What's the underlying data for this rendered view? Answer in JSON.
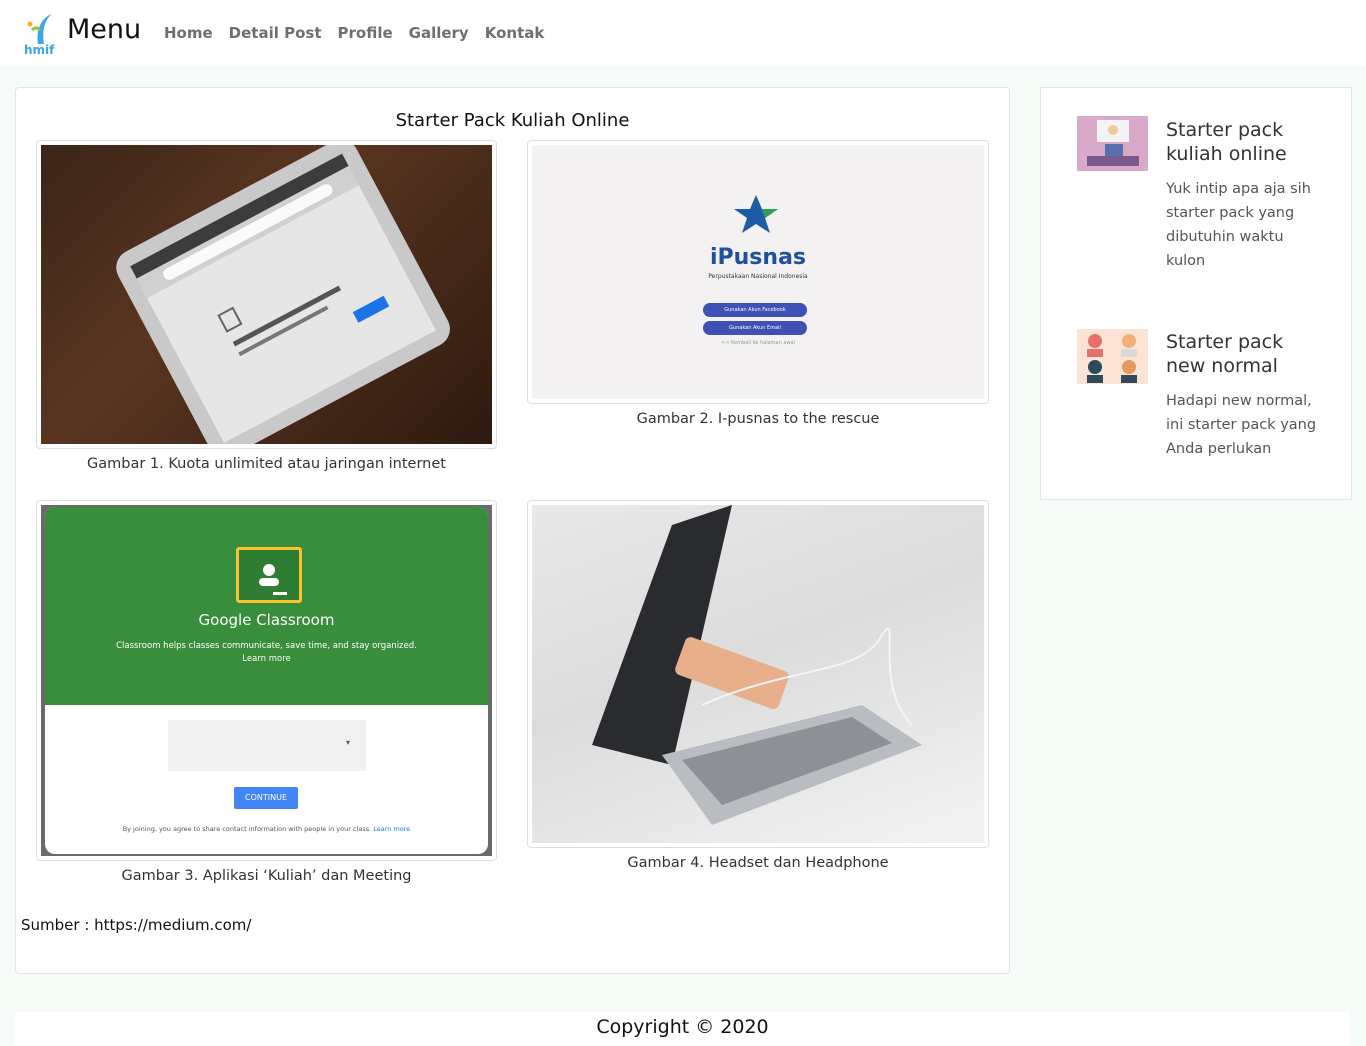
{
  "nav": {
    "logo_text": "hmif",
    "brand": "Menu",
    "links": [
      "Home",
      "Detail Post",
      "Profile",
      "Gallery",
      "Kontak"
    ]
  },
  "article": {
    "title": "Starter Pack Kuliah Online",
    "figures": [
      {
        "caption": "Gambar 1. Kuota unlimited atau jaringan internet",
        "image": "tablet-browser-photo"
      },
      {
        "caption": "Gambar 2. I-pusnas to the rescue",
        "image": "ipusnas-login-screen",
        "image_text": {
          "app_name": "iPusnas",
          "subtitle": "Perpustakaan Nasional Indonesia",
          "btn1": "Gunakan Akun Facebook",
          "btn2": "Gunakan Akun Email",
          "back": "<< Kembali ke halaman awal"
        }
      },
      {
        "caption": "Gambar 3. Aplikasi ‘Kuliah’ dan Meeting",
        "image": "google-classroom-screen",
        "image_text": {
          "app_name": "Google Classroom",
          "tagline": "Classroom helps classes communicate, save time, and stay organized.",
          "learn_more": "Learn more",
          "continue": "CONTINUE",
          "terms": "By joining, you agree to share contact information with people in your class.",
          "terms_link": "Learn more"
        }
      },
      {
        "caption": "Gambar 4. Headset dan Headphone",
        "image": "laptop-earphones-photo"
      }
    ],
    "source": "Sumber : https://medium.com/"
  },
  "sidebar": {
    "items": [
      {
        "title": "Starter pack kuliah online",
        "text": "Yuk intip apa aja sih starter pack yang dibutuhin waktu kulon"
      },
      {
        "title": "Starter pack new normal",
        "text": "Hadapi new normal, ini starter pack yang Anda perlukan"
      }
    ]
  },
  "footer": {
    "copyright": "Copyright © 2020"
  },
  "colors": {
    "page_bg": "#f5fcf8",
    "classroom_green": "#388e3c",
    "ipusnas_blue": "#3f51b5",
    "continue_blue": "#4285f4"
  }
}
